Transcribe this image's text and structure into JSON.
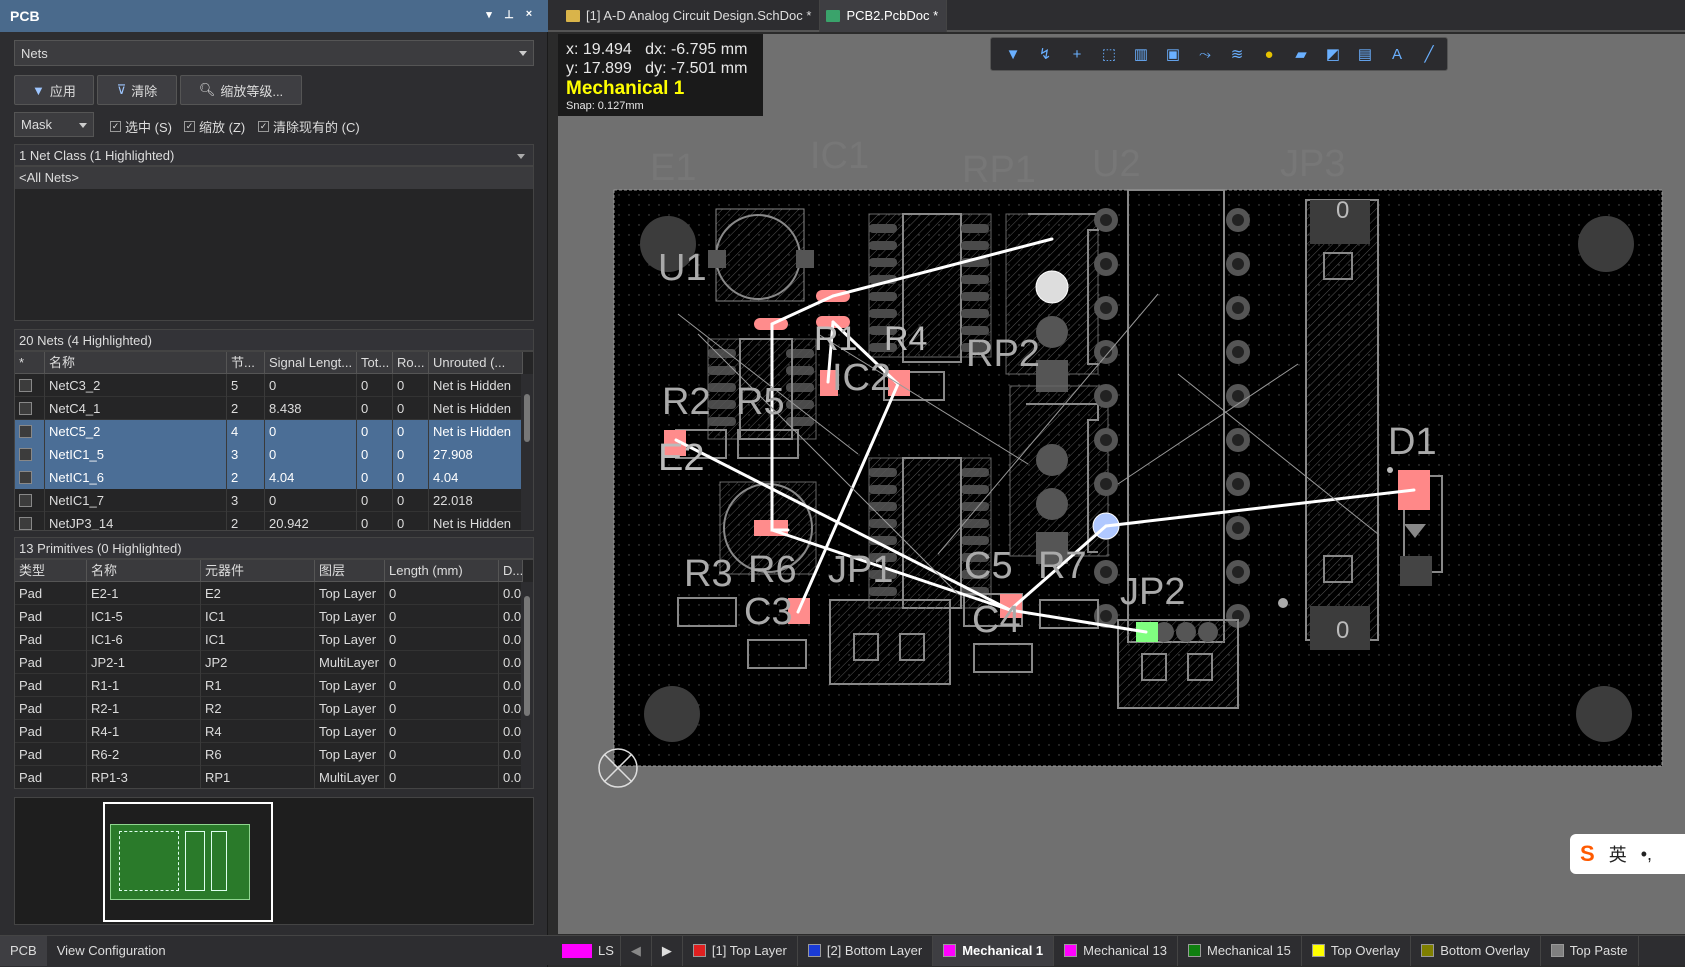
{
  "panel": {
    "title": "PCB",
    "controls": [
      "▾",
      "⊥",
      "×"
    ],
    "mode_select": "Nets",
    "buttons": {
      "apply": "应用",
      "clear": "清除",
      "zoom": "缩放等级..."
    },
    "mask_select": "Mask",
    "checks": [
      {
        "label": "选中 (S)",
        "checked": true
      },
      {
        "label": "缩放 (Z)",
        "checked": true
      },
      {
        "label": "清除现有的 (C)",
        "checked": true
      }
    ],
    "net_class_header": "1 Net Class (1 Highlighted)",
    "net_class_items": [
      "<All Nets>"
    ],
    "nets_header": "20 Nets (4 Highlighted)",
    "nets_columns": [
      "*",
      "名称",
      "节...",
      "Signal Lengt...",
      "Tot...",
      "Ro...",
      "Unrouted (..."
    ],
    "nets": [
      {
        "name": "NetC3_2",
        "nodes": "5",
        "signal": "0",
        "tot": "0",
        "ro": "0",
        "unrouted": "Net is Hidden",
        "hl": false
      },
      {
        "name": "NetC4_1",
        "nodes": "2",
        "signal": "8.438",
        "tot": "0",
        "ro": "0",
        "unrouted": "Net is Hidden",
        "hl": false
      },
      {
        "name": "NetC5_2",
        "nodes": "4",
        "signal": "0",
        "tot": "0",
        "ro": "0",
        "unrouted": "Net is Hidden",
        "hl": true
      },
      {
        "name": "NetIC1_5",
        "nodes": "3",
        "signal": "0",
        "tot": "0",
        "ro": "0",
        "unrouted": "27.908",
        "hl": true
      },
      {
        "name": "NetIC1_6",
        "nodes": "2",
        "signal": "4.04",
        "tot": "0",
        "ro": "0",
        "unrouted": "4.04",
        "hl": true
      },
      {
        "name": "NetIC1_7",
        "nodes": "3",
        "signal": "0",
        "tot": "0",
        "ro": "0",
        "unrouted": "22.018",
        "hl": false
      },
      {
        "name": "NetJP3_14",
        "nodes": "2",
        "signal": "20.942",
        "tot": "0",
        "ro": "0",
        "unrouted": "Net is Hidden",
        "hl": false
      }
    ],
    "prims_header": "13 Primitives (0 Highlighted)",
    "prims_columns": [
      "类型",
      "名称",
      "元器件",
      "图层",
      "Length (mm)",
      "D..."
    ],
    "prims": [
      {
        "type": "Pad",
        "name": "E2-1",
        "comp": "E2",
        "layer": "Top Layer",
        "len": "0",
        "d": "0.0"
      },
      {
        "type": "Pad",
        "name": "IC1-5",
        "comp": "IC1",
        "layer": "Top Layer",
        "len": "0",
        "d": "0.0"
      },
      {
        "type": "Pad",
        "name": "IC1-6",
        "comp": "IC1",
        "layer": "Top Layer",
        "len": "0",
        "d": "0.0"
      },
      {
        "type": "Pad",
        "name": "JP2-1",
        "comp": "JP2",
        "layer": "MultiLayer",
        "len": "0",
        "d": "0.0"
      },
      {
        "type": "Pad",
        "name": "R1-1",
        "comp": "R1",
        "layer": "Top Layer",
        "len": "0",
        "d": "0.0"
      },
      {
        "type": "Pad",
        "name": "R2-1",
        "comp": "R2",
        "layer": "Top Layer",
        "len": "0",
        "d": "0.0"
      },
      {
        "type": "Pad",
        "name": "R4-1",
        "comp": "R4",
        "layer": "Top Layer",
        "len": "0",
        "d": "0.0"
      },
      {
        "type": "Pad",
        "name": "R6-2",
        "comp": "R6",
        "layer": "Top Layer",
        "len": "0",
        "d": "0.0"
      },
      {
        "type": "Pad",
        "name": "RP1-3",
        "comp": "RP1",
        "layer": "MultiLayer",
        "len": "0",
        "d": "0.0"
      }
    ],
    "bottom_tabs": [
      "PCB",
      "View Configuration"
    ]
  },
  "doc_tabs": [
    {
      "label": "[1] A-D Analog Circuit Design.SchDoc *",
      "active": false,
      "color": "#d9b44a"
    },
    {
      "label": "PCB2.PcbDoc *",
      "active": true,
      "color": "#3aa36b"
    }
  ],
  "coords": {
    "x": "x: 19.494",
    "dx": "dx: -6.795 mm",
    "y": "y: 17.899",
    "dy": "dy: -7.501  mm",
    "layer": "Mechanical 1",
    "snap": "Snap: 0.127mm"
  },
  "toolbar_icons": [
    "filter-icon",
    "route-icon",
    "plus-icon",
    "select-rect-icon",
    "bar-chart-icon",
    "component-icon",
    "interactive-route-icon",
    "diff-pair-icon",
    "via-icon",
    "fill-icon",
    "region-icon",
    "graph-icon",
    "text-icon",
    "line-icon"
  ],
  "designators": [
    "E1",
    "IC1",
    "RP1",
    "U2",
    "JP3",
    "U1",
    "R1",
    "R4",
    "RP2",
    "IC2",
    "R2",
    "R5",
    "E2",
    "D1",
    "R3",
    "R6",
    "JP1",
    "C5",
    "R7",
    "JP2",
    "C3",
    "C4",
    "0",
    "0"
  ],
  "layer_bar": {
    "ls": "LS",
    "layers": [
      {
        "label": "[1] Top Layer",
        "color": "#e02020",
        "active": false
      },
      {
        "label": "[2] Bottom Layer",
        "color": "#1a3bd6",
        "active": false
      },
      {
        "label": "Mechanical 1",
        "color": "#ff00ff",
        "active": true
      },
      {
        "label": "Mechanical 13",
        "color": "#ff00ff",
        "active": false
      },
      {
        "label": "Mechanical 15",
        "color": "#108010",
        "active": false
      },
      {
        "label": "Top Overlay",
        "color": "#ffff00",
        "active": false
      },
      {
        "label": "Bottom Overlay",
        "color": "#808000",
        "active": false
      },
      {
        "label": "Top Paste",
        "color": "#808080",
        "active": false
      }
    ]
  },
  "ime": {
    "label": "英"
  }
}
